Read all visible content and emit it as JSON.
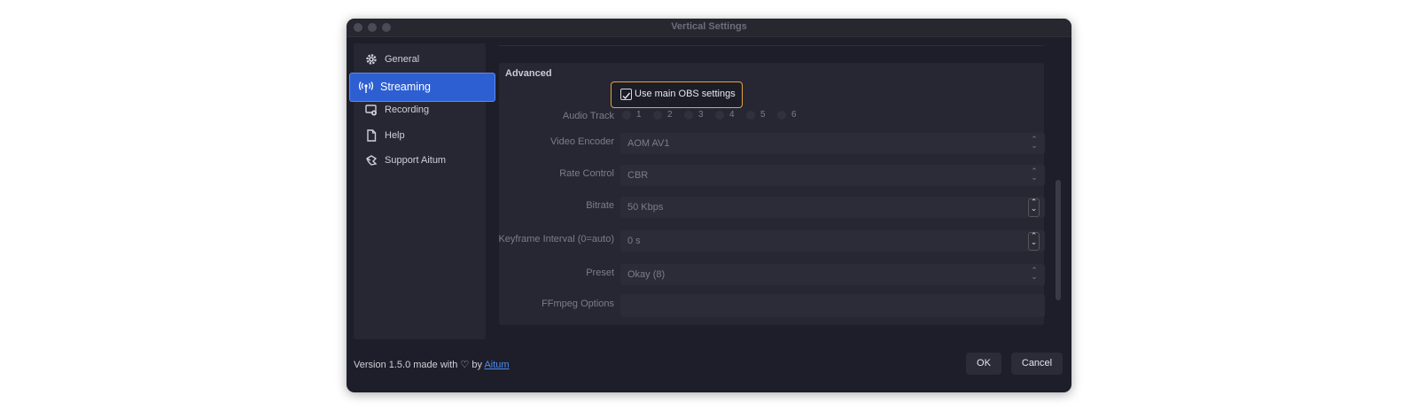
{
  "window": {
    "title": "Vertical Settings"
  },
  "sidebar": {
    "items": [
      {
        "label": "General",
        "icon": "gear-icon"
      },
      {
        "label": "Streaming",
        "icon": "antenna-icon",
        "active": true
      },
      {
        "label": "Recording",
        "icon": "recording-icon"
      },
      {
        "label": "Help",
        "icon": "document-icon"
      },
      {
        "label": "Support Aitum",
        "icon": "support-icon"
      }
    ]
  },
  "advanced": {
    "section_title": "Advanced",
    "use_main_checkbox": {
      "label": "Use main OBS settings",
      "checked": true
    },
    "audio_track": {
      "label": "Audio Track",
      "options": [
        "1",
        "2",
        "3",
        "4",
        "5",
        "6"
      ]
    },
    "video_encoder": {
      "label": "Video Encoder",
      "value": "AOM AV1"
    },
    "rate_control": {
      "label": "Rate Control",
      "value": "CBR"
    },
    "bitrate": {
      "label": "Bitrate",
      "value": "50 Kbps"
    },
    "keyframe_interval": {
      "label": "Keyframe Interval (0=auto)",
      "value": "0 s"
    },
    "preset": {
      "label": "Preset",
      "value": "Okay (8)"
    },
    "ffmpeg_options": {
      "label": "FFmpeg Options",
      "value": ""
    }
  },
  "footer": {
    "version_text": "Version 1.5.0 made with ♡ by",
    "link_text": "Aitum",
    "ok_label": "OK",
    "cancel_label": "Cancel"
  },
  "colors": {
    "accent": "#2d5fd2",
    "highlight": "#e6a23c",
    "link": "#4f8df0"
  }
}
